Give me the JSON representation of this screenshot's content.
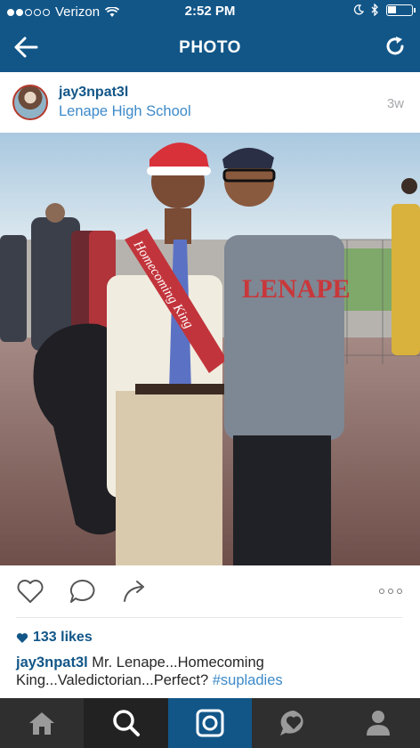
{
  "status_bar": {
    "carrier": "Verizon",
    "time": "2:52 PM"
  },
  "nav": {
    "title": "PHOTO",
    "back_icon": "back-arrow-icon",
    "refresh_icon": "refresh-icon"
  },
  "post": {
    "username": "jay3npat3l",
    "location": "Lenape High School",
    "age": "3w",
    "likes": "133 likes",
    "caption_user": "jay3npat3l",
    "caption_text": " Mr. Lenape...Homecoming King...Valedictorian...Perfect? ",
    "hashtag": "#supladies",
    "photo_texts": {
      "sash": "Homecoming King",
      "hoodie": "LENAPE"
    }
  },
  "tabs": [
    {
      "name": "home",
      "icon": "home-icon"
    },
    {
      "name": "search",
      "icon": "search-icon"
    },
    {
      "name": "camera",
      "icon": "camera-icon"
    },
    {
      "name": "activity",
      "icon": "heart-bubble-icon"
    },
    {
      "name": "profile",
      "icon": "profile-icon"
    }
  ],
  "colors": {
    "brand": "#125688",
    "link": "#3d8ac9",
    "tabbar": "#2f2f2f"
  }
}
